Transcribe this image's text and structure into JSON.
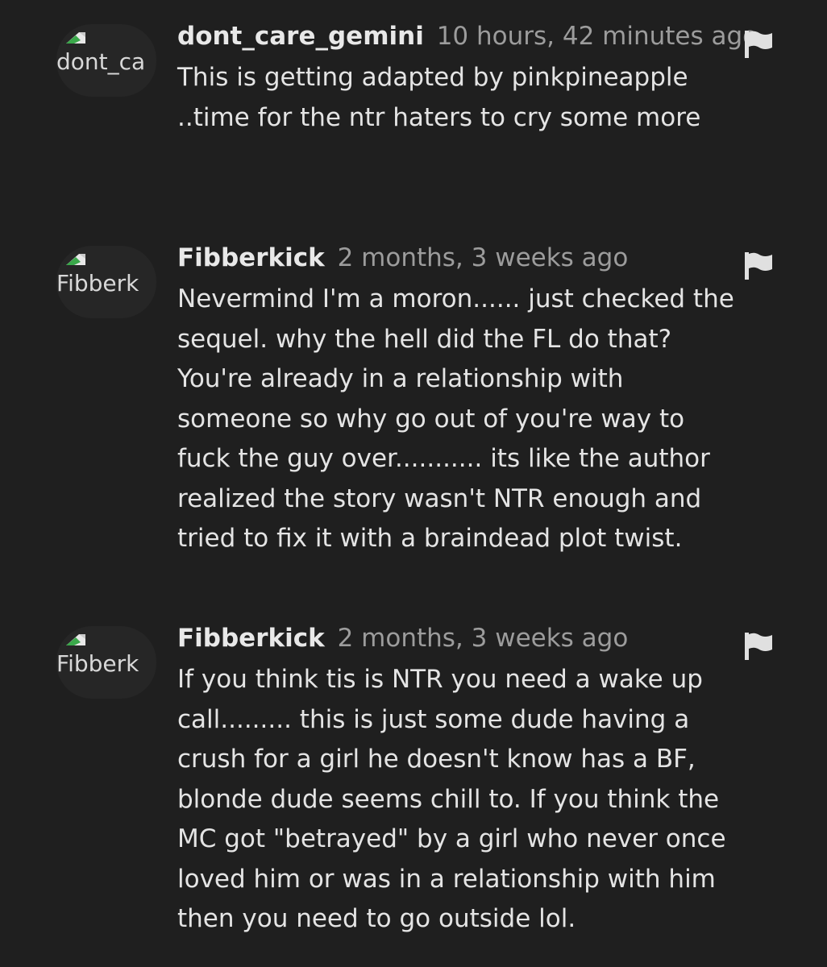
{
  "comments": [
    {
      "avatar_alt": "dont_ca",
      "username": "dont_care_gemini",
      "time": "10 hours, 42 minutes ago",
      "text": "This is getting adapted by pinkpineapple\n..time for the ntr haters to cry some more"
    },
    {
      "avatar_alt": "Fibberk",
      "username": "Fibberkick",
      "time": "2 months, 3 weeks ago",
      "text": "Nevermind I'm a moron...... just checked the\nsequel. why the hell did the FL do that?\nYou're already in a relationship with\nsomeone so why go out of you're way to\nfuck the guy over........... its like the author\nrealized the story wasn't NTR enough and\ntried to fix it with a braindead plot twist."
    },
    {
      "avatar_alt": "Fibberk",
      "username": "Fibberkick",
      "time": "2 months, 3 weeks ago",
      "text": "If you think tis is NTR you need a wake up\ncall......... this is just some dude having a\ncrush for a girl he doesn't know has a BF,\nblonde dude seems chill to. If you think the\nMC got \"betrayed\" by a girl who never once\nloved him or was in a relationship with him\nthen you need to go outside lol."
    }
  ],
  "icons": {
    "flag": "flag-icon",
    "avatar_placeholder": "broken-image-icon"
  },
  "colors": {
    "background": "#1f1f1f",
    "text": "#e4e4e4",
    "muted": "#9c9c9c"
  }
}
